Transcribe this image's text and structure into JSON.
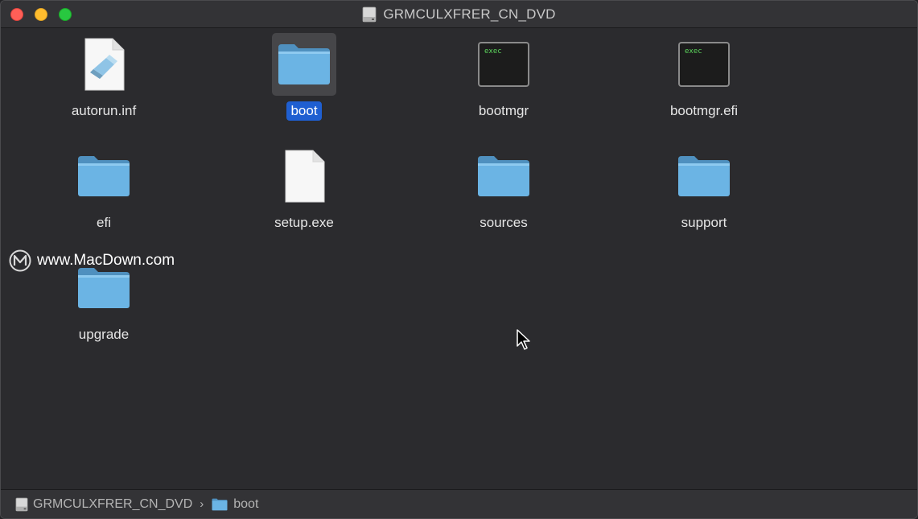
{
  "window": {
    "title": "GRMCULXFRER_CN_DVD"
  },
  "items": [
    {
      "name": "autorun.inf",
      "kind": "document-icon",
      "selected": false
    },
    {
      "name": "boot",
      "kind": "folder-icon",
      "selected": true
    },
    {
      "name": "bootmgr",
      "kind": "exec-icon",
      "exec_text": "exec",
      "selected": false
    },
    {
      "name": "bootmgr.efi",
      "kind": "exec-icon",
      "exec_text": "exec",
      "selected": false
    },
    {
      "name": "efi",
      "kind": "folder-icon",
      "selected": false
    },
    {
      "name": "setup.exe",
      "kind": "blank-file-icon",
      "selected": false
    },
    {
      "name": "sources",
      "kind": "folder-icon",
      "selected": false
    },
    {
      "name": "support",
      "kind": "folder-icon",
      "selected": false
    },
    {
      "name": "upgrade",
      "kind": "folder-icon",
      "selected": false
    }
  ],
  "watermark": {
    "text": "www.MacDown.com"
  },
  "path_bar": {
    "crumbs": [
      "GRMCULXFRER_CN_DVD",
      "boot"
    ]
  },
  "colors": {
    "selection": "#1f5fd1",
    "folder": "#6bb4e4",
    "close": "#ff5f57",
    "minimize": "#febc2e",
    "maximize": "#28c840"
  }
}
